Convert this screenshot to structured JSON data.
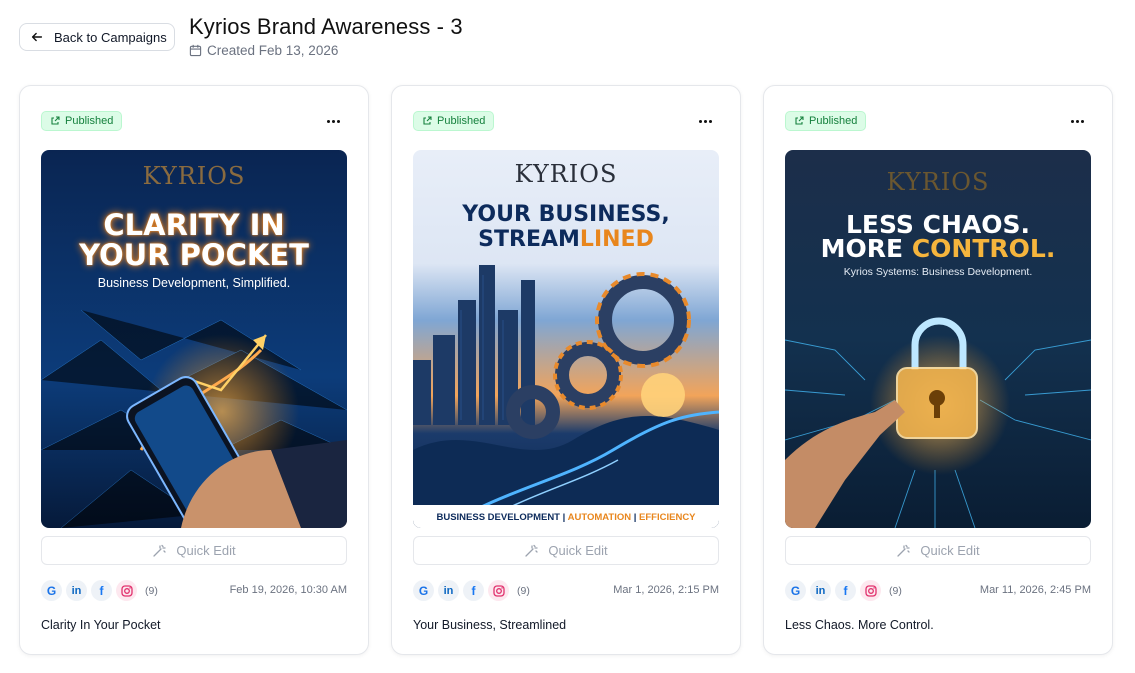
{
  "header": {
    "back_label": "Back to Campaigns",
    "title": "Kyrios Brand Awareness - 3",
    "created": "Created Feb 13, 2026"
  },
  "cards": [
    {
      "status": "Published",
      "poster": {
        "brand": "KYRIOS",
        "headline_1": "CLARITY IN",
        "headline_2": "YOUR POCKET",
        "subtitle": "Business Development, Simplified."
      },
      "quick_edit": "Quick Edit",
      "count": "(9)",
      "date": "Feb 19, 2026, 10:30 AM",
      "caption": "Clarity In Your Pocket"
    },
    {
      "status": "Published",
      "poster": {
        "brand": "KYRIOS",
        "headline_1": "YOUR BUSINESS,",
        "headline_2a": "STREAM",
        "headline_2b": "LINED",
        "footer_1": "BUSINESS DEVELOPMENT",
        "footer_sep": " | ",
        "footer_2": "AUTOMATION",
        "footer_3": "EFFICIENCY"
      },
      "quick_edit": "Quick Edit",
      "count": "(9)",
      "date": "Mar 1, 2026, 2:15 PM",
      "caption": "Your Business, Streamlined"
    },
    {
      "status": "Published",
      "poster": {
        "brand": "KYRIOS",
        "headline_1": "LESS CHAOS.",
        "headline_2a": "MORE ",
        "headline_2b": "CONTROL.",
        "subtitle": "Kyrios Systems: Business Development."
      },
      "quick_edit": "Quick Edit",
      "count": "(9)",
      "date": "Mar 11, 2026, 2:45 PM",
      "caption": "Less Chaos. More Control."
    }
  ],
  "social_icons": [
    "google-icon",
    "linkedin-icon",
    "facebook-icon",
    "instagram-icon"
  ],
  "colors": {
    "published_bg": "#dcfce7",
    "published_text": "#15803d",
    "accent_orange": "#f59e0b",
    "poster_navy": "#0b1f44"
  }
}
